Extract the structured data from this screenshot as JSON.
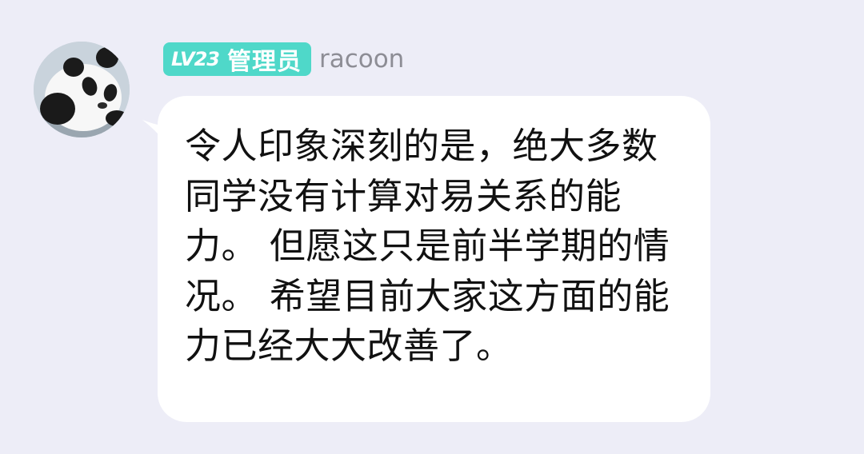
{
  "message": {
    "sender": {
      "avatar_icon": "panda-avatar",
      "level": "LV23",
      "role": "管理员",
      "name": "racoon"
    },
    "text": "令人印象深刻的是，绝大多数同学没有计算对易关系的能力。 但愿这只是前半学期的情况。 希望目前大家这方面的能力已经大大改善了。"
  },
  "colors": {
    "background": "#ededf7",
    "bubble": "#ffffff",
    "badge": "#4fd8c9",
    "username": "#8d8d95",
    "text": "#111111"
  }
}
